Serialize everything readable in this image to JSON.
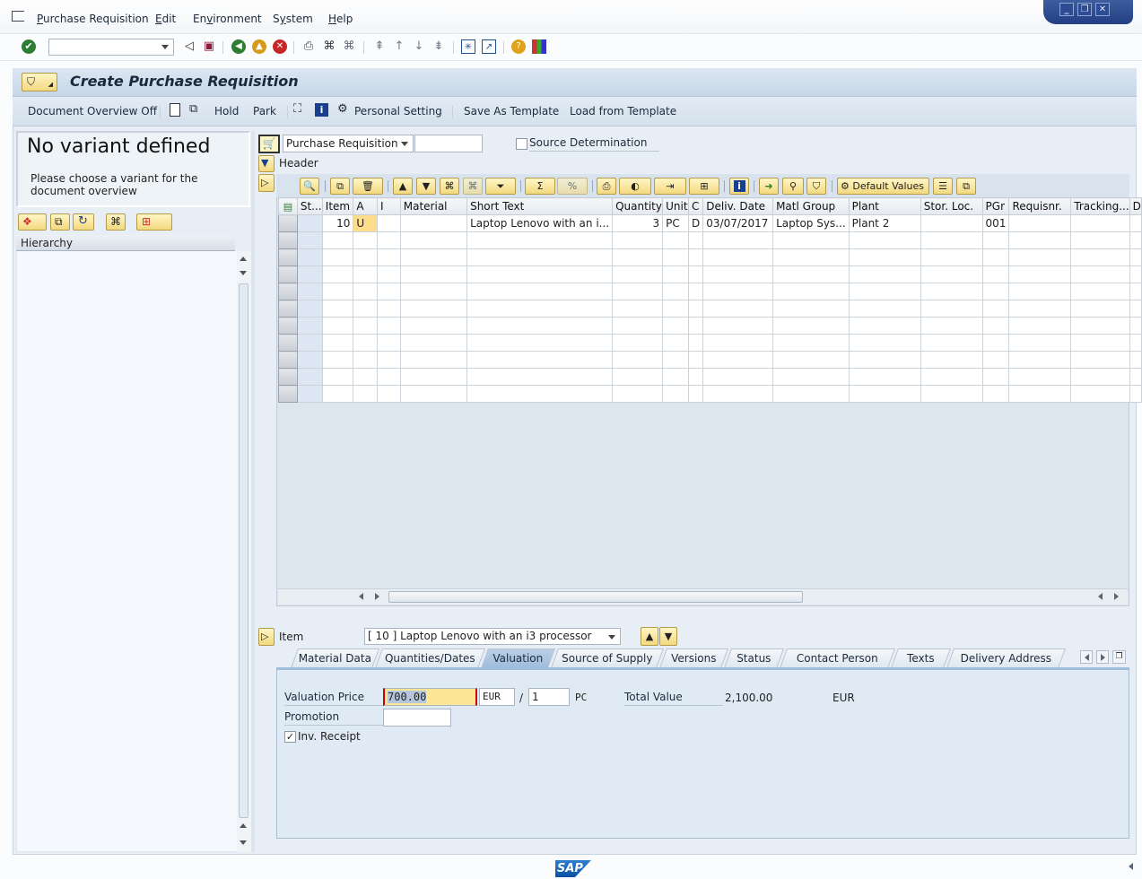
{
  "menu": {
    "items": [
      {
        "label": "Purchase Requisition",
        "underline": "P"
      },
      {
        "label": "Edit",
        "underline": "E"
      },
      {
        "label": "Environment",
        "underline": "v"
      },
      {
        "label": "System",
        "underline": "y"
      },
      {
        "label": "Help",
        "underline": "H"
      }
    ]
  },
  "window_controls": {
    "minimize": "_",
    "restore": "❐",
    "close": "✕"
  },
  "toolbar": {
    "command_field_value": "",
    "icons": [
      "enter-icon",
      "back-icon",
      "save-icon",
      "back-green-icon",
      "exit-icon",
      "cancel-icon",
      "print-icon",
      "find-icon",
      "find-next-icon",
      "first-page-icon",
      "prev-page-icon",
      "next-page-icon",
      "last-page-icon",
      "create-session-icon",
      "shortcut-icon",
      "help-icon",
      "customize-layout-icon"
    ]
  },
  "app": {
    "title": "Create Purchase Requisition",
    "toolbar": {
      "document_overview_off": "Document Overview Off",
      "hold": "Hold",
      "park": "Park",
      "personal_setting": "Personal Setting",
      "save_as_template": "Save As Template",
      "load_from_template": "Load from Template"
    }
  },
  "left_panel": {
    "variant_title": "No variant defined",
    "variant_hint": "Please choose a variant for the document overview",
    "hierarchy_header": "Hierarchy"
  },
  "header_area": {
    "doc_type": "Purchase Requisition",
    "doc_number": "",
    "source_determination_label": "Source Determination",
    "source_determination_checked": false,
    "header_label": "Header"
  },
  "grid": {
    "default_values_label": "Default Values",
    "columns": [
      "St...",
      "Item",
      "A",
      "I",
      "Material",
      "Short Text",
      "Quantity",
      "Unit",
      "C",
      "Deliv. Date",
      "Matl Group",
      "Plant",
      "Stor. Loc.",
      "PGr",
      "Requisnr.",
      "Tracking...",
      "D"
    ],
    "rows": [
      [
        "",
        "10",
        "U",
        "",
        "",
        "Laptop Lenovo with an i...",
        "3",
        "PC",
        "D",
        "03/07/2017",
        "Laptop Sys...",
        "Plant 2",
        "",
        "001",
        "",
        "",
        ""
      ]
    ],
    "empty_rows": 10
  },
  "item_detail": {
    "item_label": "Item",
    "item_selected": "[ 10 ] Laptop Lenovo with an i3 processor",
    "tabs": [
      "Material Data",
      "Quantities/Dates",
      "Valuation",
      "Source of Supply",
      "Versions",
      "Status",
      "Contact Person",
      "Texts",
      "Delivery Address"
    ],
    "active_tab": "Valuation",
    "valuation": {
      "valuation_price_label": "Valuation Price",
      "valuation_price": "700.00",
      "currency": "EUR",
      "per_separator": "/",
      "price_unit": "1",
      "unit": "PC",
      "total_value_label": "Total Value",
      "total_value": "2,100.00",
      "total_currency": "EUR",
      "promotion_label": "Promotion",
      "promotion_value": "",
      "inv_receipt_label": "Inv. Receipt",
      "inv_receipt_checked": true
    }
  },
  "status": {
    "logo": "SAP"
  }
}
